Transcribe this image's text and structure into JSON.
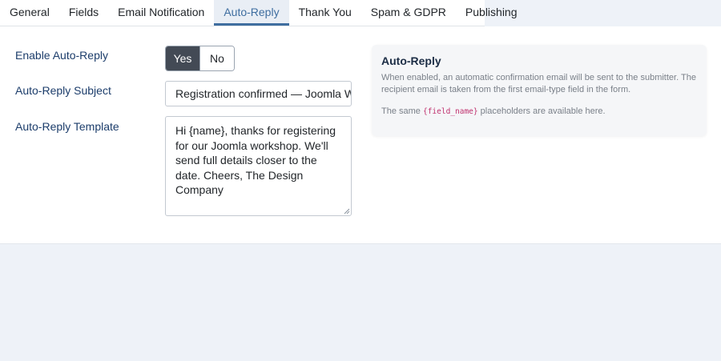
{
  "tabs": [
    {
      "label": "General",
      "active": false
    },
    {
      "label": "Fields",
      "active": false
    },
    {
      "label": "Email Notification",
      "active": false
    },
    {
      "label": "Auto-Reply",
      "active": true
    },
    {
      "label": "Thank You",
      "active": false
    },
    {
      "label": "Spam & GDPR",
      "active": false
    },
    {
      "label": "Publishing",
      "active": false
    }
  ],
  "form": {
    "enable_label": "Enable Auto-Reply",
    "enable_yes": "Yes",
    "enable_no": "No",
    "enable_selected": "Yes",
    "subject_label": "Auto-Reply Subject",
    "subject_value": "Registration confirmed — Joomla Wor",
    "template_label": "Auto-Reply Template",
    "template_value": "Hi {name}, thanks for registering for our Joomla workshop. We'll send full details closer to the date. Cheers, The Design Company"
  },
  "info": {
    "title": "Auto-Reply",
    "text1": "When enabled, an automatic confirmation email will be sent to the submitter. The recipient email is taken from the first email-type field in the form.",
    "text2_before": "The same ",
    "text2_code": "{field_name}",
    "text2_after": " placeholders are available here."
  },
  "colors": {
    "accent": "#3f6ea0",
    "toggle_on": "#434a55",
    "label": "#1c3d6b",
    "code": "#c0316e"
  }
}
